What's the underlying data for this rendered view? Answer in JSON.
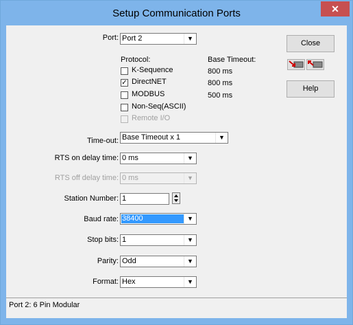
{
  "window": {
    "title": "Setup Communication Ports",
    "close_glyph": "✕"
  },
  "port": {
    "label": "Port:",
    "value": "Port 2"
  },
  "protocol": {
    "header": "Protocol:",
    "timeout_header": "Base Timeout:",
    "items": [
      {
        "label": "K-Sequence",
        "checked": false,
        "enabled": true,
        "timeout": "800 ms"
      },
      {
        "label": "DirectNET",
        "checked": true,
        "enabled": true,
        "timeout": "800 ms"
      },
      {
        "label": "MODBUS",
        "checked": false,
        "enabled": true,
        "timeout": "500 ms"
      },
      {
        "label": "Non-Seq(ASCII)",
        "checked": false,
        "enabled": true,
        "timeout": ""
      },
      {
        "label": "Remote I/O",
        "checked": false,
        "enabled": false,
        "timeout": ""
      }
    ]
  },
  "timeout": {
    "label": "Time-out:",
    "value": "Base Timeout x 1"
  },
  "rts_on": {
    "label": "RTS on delay time:",
    "value": "0 ms"
  },
  "rts_off": {
    "label": "RTS off delay time:",
    "value": "0 ms"
  },
  "station": {
    "label": "Station Number:",
    "value": "1"
  },
  "baud": {
    "label": "Baud rate:",
    "value": "38400"
  },
  "stop_bits": {
    "label": "Stop bits:",
    "value": "1"
  },
  "parity": {
    "label": "Parity:",
    "value": "Odd"
  },
  "format": {
    "label": "Format:",
    "value": "Hex"
  },
  "buttons": {
    "close": "Close",
    "help": "Help"
  },
  "status_bar": "Port 2: 6 Pin Modular",
  "icons": {
    "dropdown": "chevron-down-icon",
    "toolbar": [
      "read-from-plc-icon",
      "write-to-plc-icon"
    ],
    "spinner": "spin-updown-icon"
  },
  "colors": {
    "title_bar": "#7eb4ea",
    "close_button": "#c75050",
    "selection": "#3399ff",
    "dialog_bg": "#f0f0f0"
  }
}
